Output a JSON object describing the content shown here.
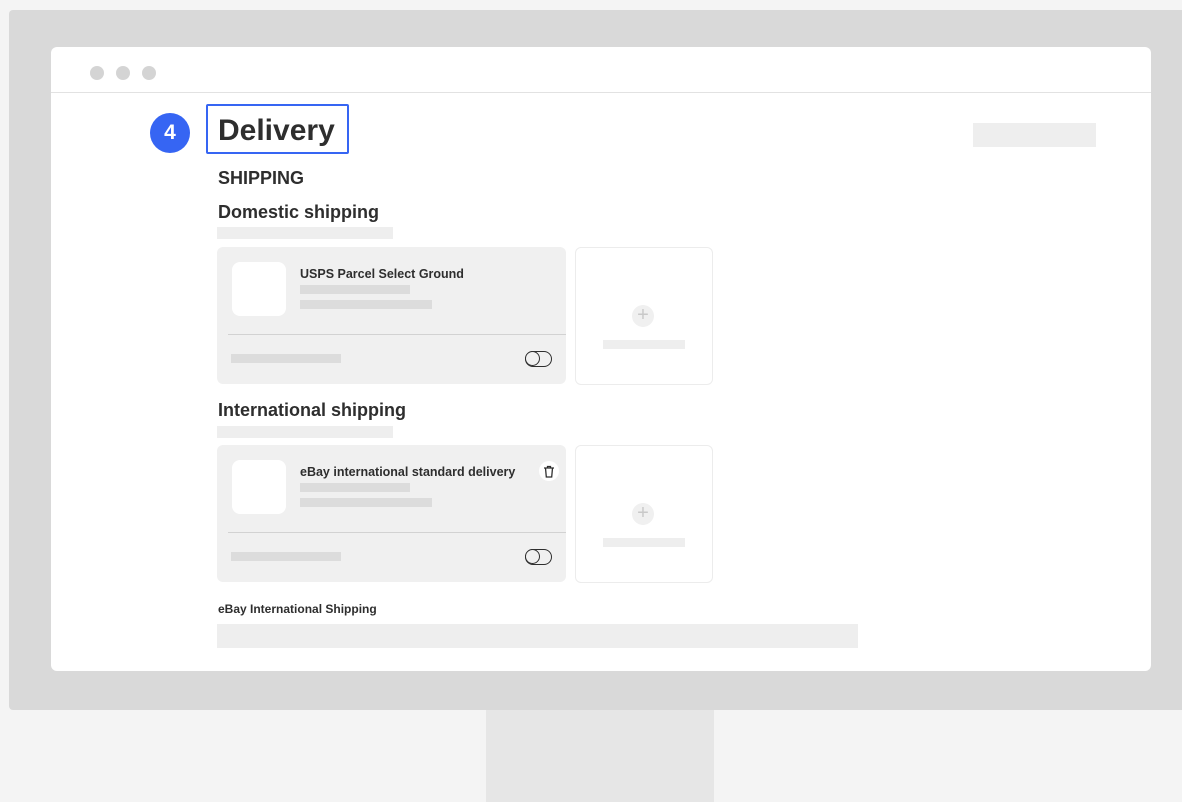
{
  "step": {
    "number": "4"
  },
  "page": {
    "title": "Delivery"
  },
  "shipping": {
    "section_label": "SHIPPING",
    "domestic": {
      "heading": "Domestic shipping",
      "service_card": {
        "title": "USPS Parcel Select Ground",
        "toggle_icon": "toggle-off-icon"
      },
      "add_card": {
        "icon": "plus-icon"
      }
    },
    "international": {
      "heading": "International shipping",
      "service_card": {
        "title": "eBay international standard delivery",
        "delete_icon": "trash-icon",
        "toggle_icon": "toggle-off-icon"
      },
      "add_card": {
        "icon": "plus-icon"
      }
    },
    "ebay_international": {
      "label": "eBay International Shipping"
    }
  },
  "colors": {
    "accent": "#3665f3",
    "placeholder": "#eeeeee",
    "card_bg": "#f0f0f0"
  }
}
